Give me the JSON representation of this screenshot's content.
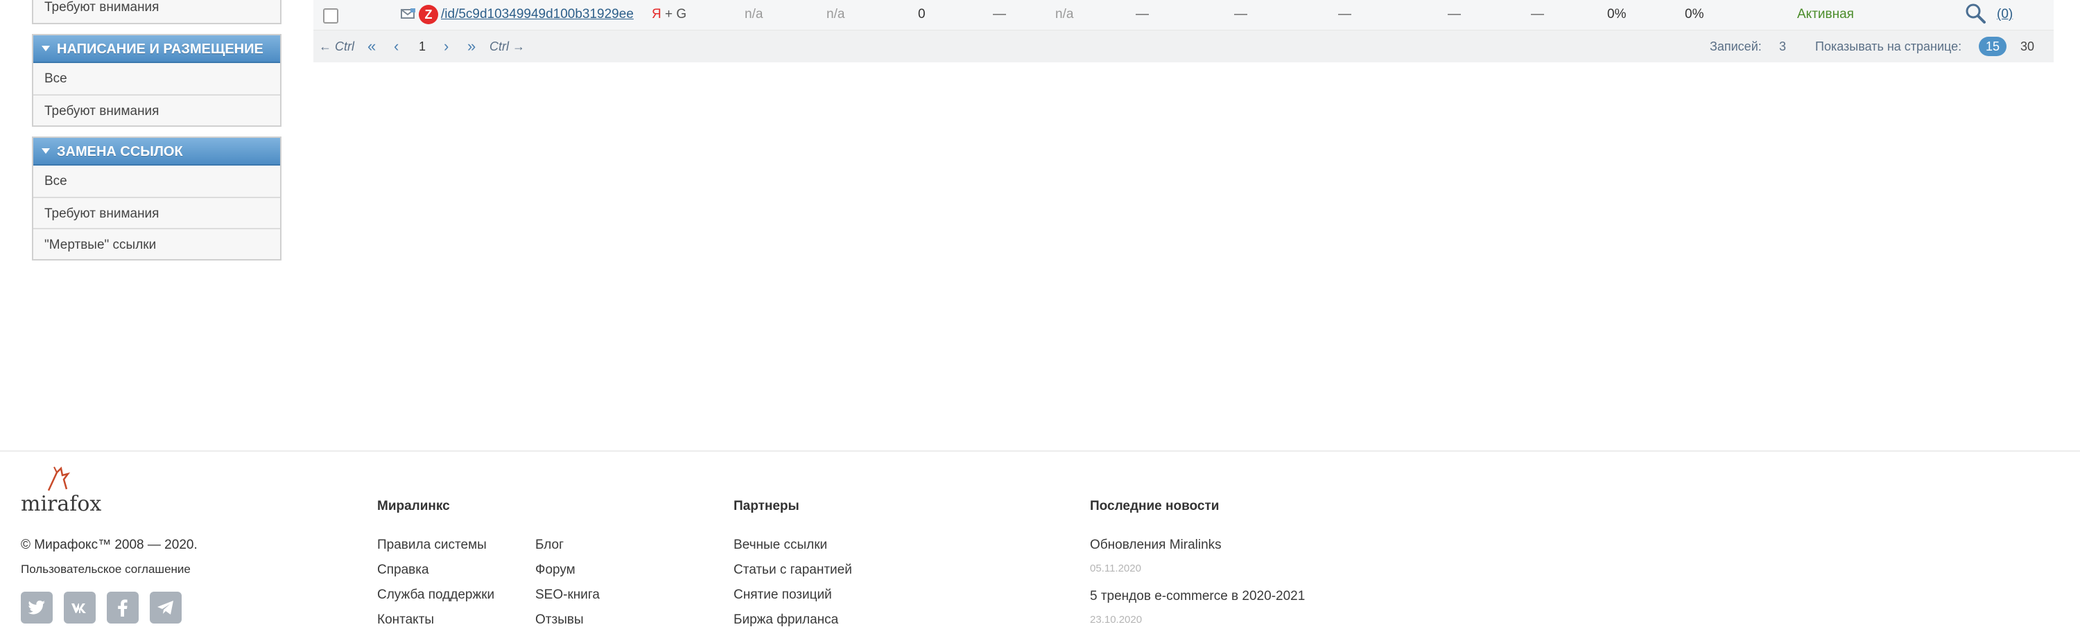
{
  "sidebar": {
    "box1": {
      "items": [
        "Требуют внимания"
      ]
    },
    "box2": {
      "title": "НАПИСАНИЕ И РАЗМЕЩЕНИЕ",
      "items": [
        "Все",
        "Требуют внимания"
      ]
    },
    "box3": {
      "title": "ЗАМЕНА ССЫЛОК",
      "items": [
        "Все",
        "Требуют внимания",
        "\"Мертвые\" ссылки"
      ]
    }
  },
  "table": {
    "row": {
      "link": "/id/5c9d10349949d100b31929ee",
      "engine_ya": "Я",
      "engine_rest": " + G",
      "col_na1": "n/a",
      "col_na2": "n/a",
      "col_zero": "0",
      "col_dash1": "—",
      "col_na3": "n/a",
      "col_dash2": "—",
      "col_dash3": "—",
      "col_dash4": "—",
      "col_dash5": "—",
      "col_dash6": "—",
      "pct1": "0%",
      "pct2": "0%",
      "status": "Активная",
      "count_link": "(0)",
      "y_icon": "Z"
    },
    "pager": {
      "prev_hint": "← Ctrl",
      "first": "«",
      "prev": "‹",
      "page": "1",
      "next": "›",
      "last": "»",
      "next_hint": "Ctrl →",
      "records_label": "Записей:",
      "records_count": "3",
      "per_page_label": "Показывать на странице:",
      "per_page_selected": "15",
      "per_page_other": "30"
    }
  },
  "footer": {
    "logo": "mirafox",
    "copyright": "© Мирафокс™ 2008 — 2020.",
    "agreement": "Пользовательское соглашение",
    "col1": {
      "title": "Миралинкс",
      "left": [
        "Правила системы",
        "Справка",
        "Служба поддержки",
        "Контакты"
      ],
      "right": [
        "Блог",
        "Форум",
        "SEO-книга",
        "Отзывы"
      ]
    },
    "col2": {
      "title": "Партнеры",
      "items": [
        "Вечные ссылки",
        "Статьи с гарантией",
        "Снятие позиций",
        "Биржа фриланса"
      ]
    },
    "col3": {
      "title": "Последние новости",
      "news": [
        {
          "title": "Обновления Miralinks",
          "date": "05.11.2020"
        },
        {
          "title": "5 трендов e-commerce в 2020-2021",
          "date": "23.10.2020"
        }
      ]
    }
  },
  "icons": [
    "mail-icon",
    "yandex-icon",
    "search-icon",
    "twitter-icon",
    "vk-icon",
    "facebook-icon",
    "telegram-icon"
  ],
  "colors": {
    "sidebar_header": "#5b97cc",
    "status_active": "#4a8c2a",
    "link": "#2d5f8a",
    "badge": "#4f93c8"
  }
}
